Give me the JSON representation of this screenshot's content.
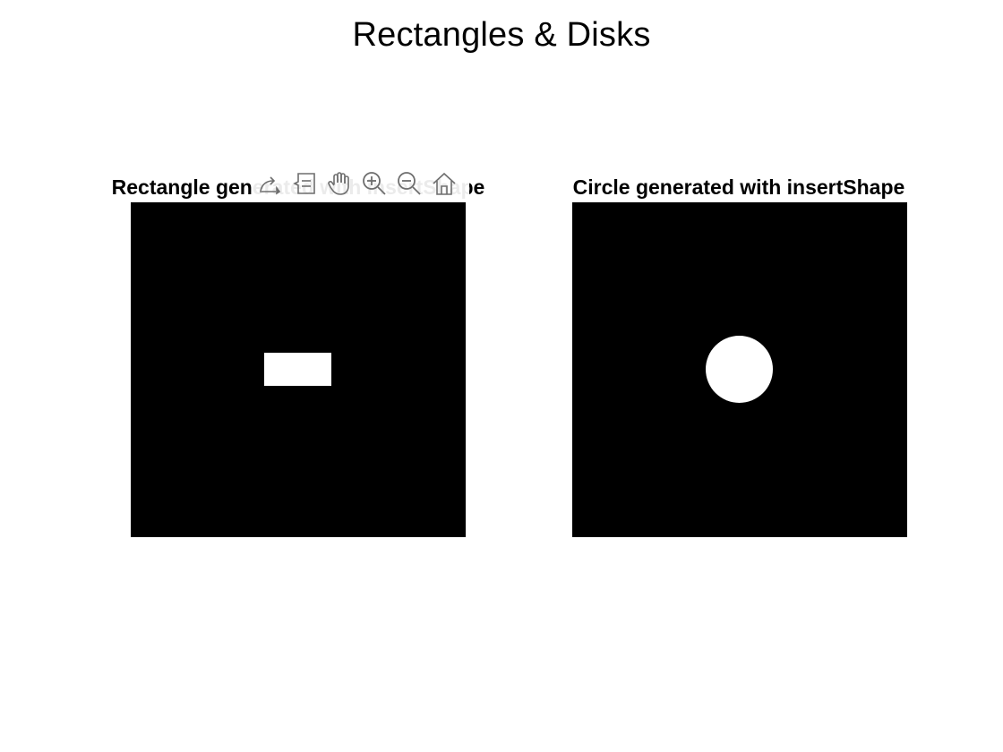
{
  "figure": {
    "title": "Rectangles & Disks"
  },
  "axes_left": {
    "title": "Rectangle generated with insertShape",
    "shape": "rectangle",
    "fill_color": "#ffffff",
    "background_color": "#000000"
  },
  "axes_right": {
    "title": "Circle generated with insertShape",
    "shape": "circle",
    "fill_color": "#ffffff",
    "background_color": "#000000"
  },
  "toolbar": {
    "icons": [
      "export-icon",
      "datatip-icon",
      "pan-icon",
      "zoom-in-icon",
      "zoom-out-icon",
      "home-icon"
    ]
  }
}
